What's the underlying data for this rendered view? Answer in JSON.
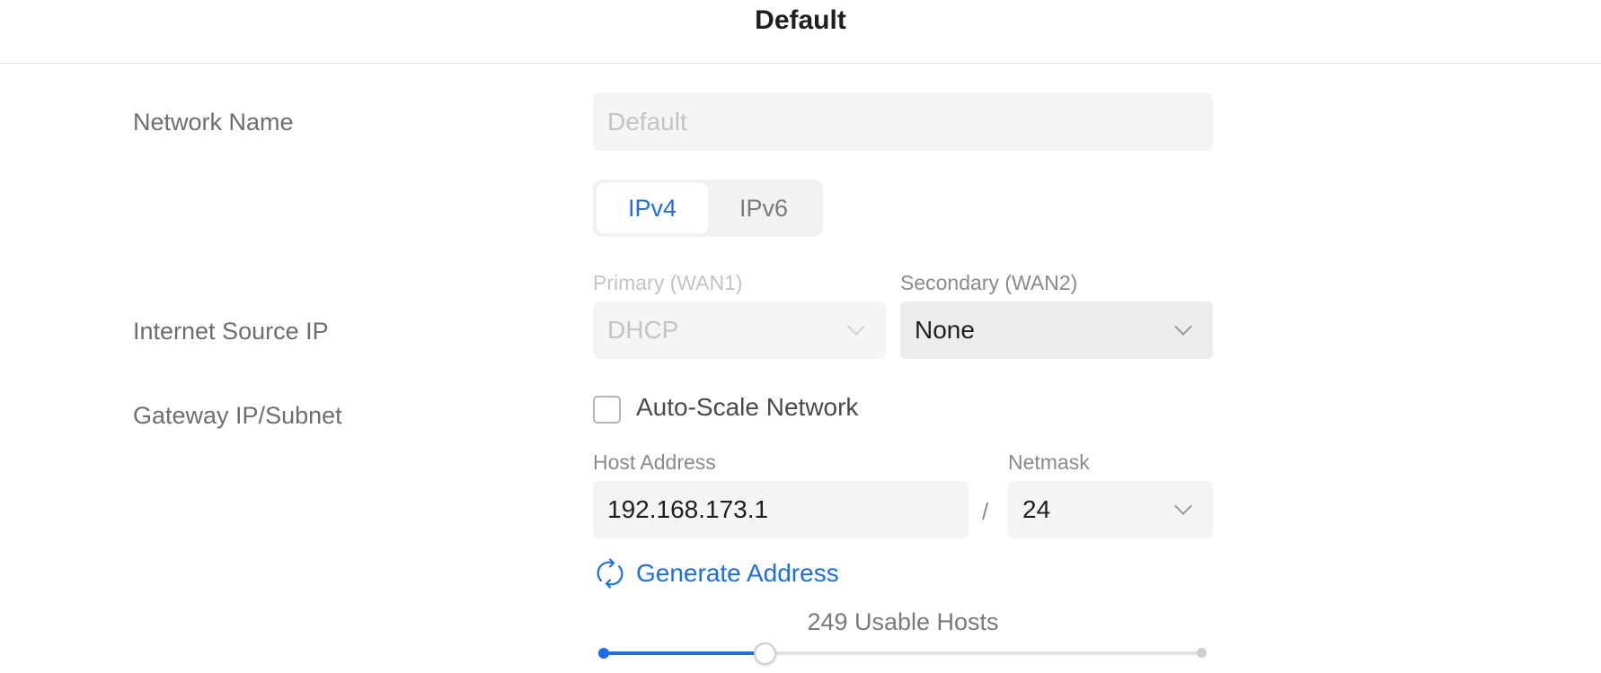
{
  "header": {
    "title": "Default"
  },
  "rows": {
    "network_name": "Network Name",
    "internet_source_ip": "Internet Source IP",
    "gateway_ip_subnet": "Gateway IP/Subnet"
  },
  "network_name_input": {
    "placeholder": "Default"
  },
  "ip_tabs": [
    {
      "label": "IPv4",
      "selected": true
    },
    {
      "label": "IPv6",
      "selected": false
    }
  ],
  "wan": {
    "primary_label": "Primary (WAN1)",
    "primary_value": "DHCP",
    "secondary_label": "Secondary (WAN2)",
    "secondary_value": "None"
  },
  "auto_scale": {
    "label": "Auto-Scale Network",
    "checked": false
  },
  "host_address": {
    "label": "Host Address",
    "value": "192.168.173.1"
  },
  "separator": "/",
  "netmask": {
    "label": "Netmask",
    "value": "24"
  },
  "generate": {
    "label": "Generate Address",
    "icon": "refresh-icon"
  },
  "hosts": {
    "text": "249 Usable Hosts",
    "slider_fraction": 0.27
  },
  "colors": {
    "accent": "#1c6fe8",
    "label": "#6e6e6e",
    "field_bg": "#f4f4f5"
  }
}
